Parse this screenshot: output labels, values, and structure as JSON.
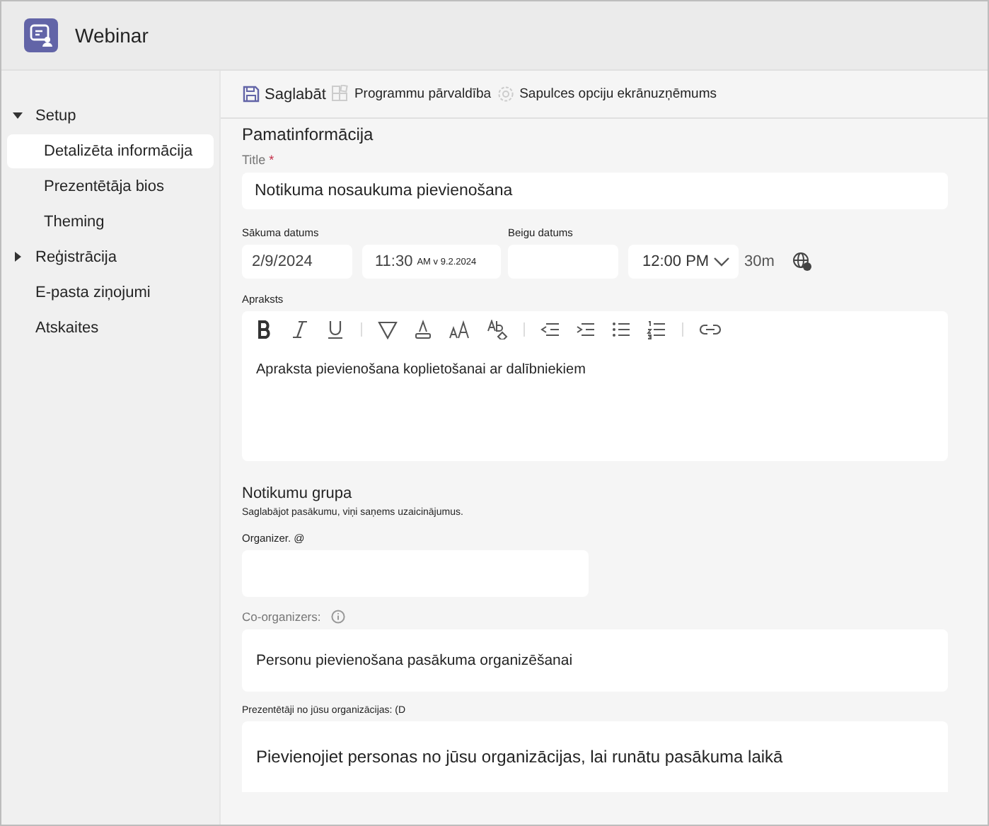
{
  "app": {
    "title": "Webinar"
  },
  "sidebar": {
    "items": [
      {
        "label": "Setup",
        "expanded": true,
        "selected": false,
        "children": [
          {
            "label": "Detalizēta informācija",
            "selected": true
          },
          {
            "label": "Prezentētāja bios",
            "selected": false
          },
          {
            "label": "Theming",
            "selected": false
          }
        ]
      },
      {
        "label": "Reģistrācija",
        "expanded": false,
        "selected": false
      },
      {
        "label": "E-pasta ziņojumi",
        "selected": false
      },
      {
        "label": "Atskaites",
        "selected": false
      }
    ]
  },
  "toolbar": {
    "items": [
      {
        "kind": "save",
        "label": "Saglabāt"
      },
      {
        "kind": "apps",
        "label": "Programmu pārvaldība"
      },
      {
        "kind": "options",
        "label": "Sapulces opciju ekrānuzņēmums"
      }
    ]
  },
  "basic": {
    "heading": "Pamatinformācija",
    "title_label": "Title",
    "required_mark": "*",
    "title_value": "Notikuma nosaukuma pievienošana",
    "start_label": "Sākuma datums",
    "start_date": "2/9/2024",
    "start_time": "11:30",
    "start_time_note": "AM v 9.2.2024",
    "end_label": "Beigu datums",
    "end_time": "12:00 PM",
    "duration": "30m",
    "description_label": "Apraksts",
    "description_value": "Apraksta pievienošana koplietošanai ar dalībniekiem"
  },
  "group": {
    "heading": "Notikumu grupa",
    "note": "Saglabājot pasākumu, viņi saņems uzaicinājumus.",
    "organizer_label": "Organizer. @",
    "coorganizers_label": "Co-organizers:",
    "coorganizers_placeholder": "Personu pievienošana pasākuma organizēšanai",
    "presenters_label": "Prezentētāji no jūsu organizācijas: (D",
    "presenters_placeholder": "Pievienojiet personas no jūsu organizācijas, lai runātu pasākuma laikā"
  }
}
